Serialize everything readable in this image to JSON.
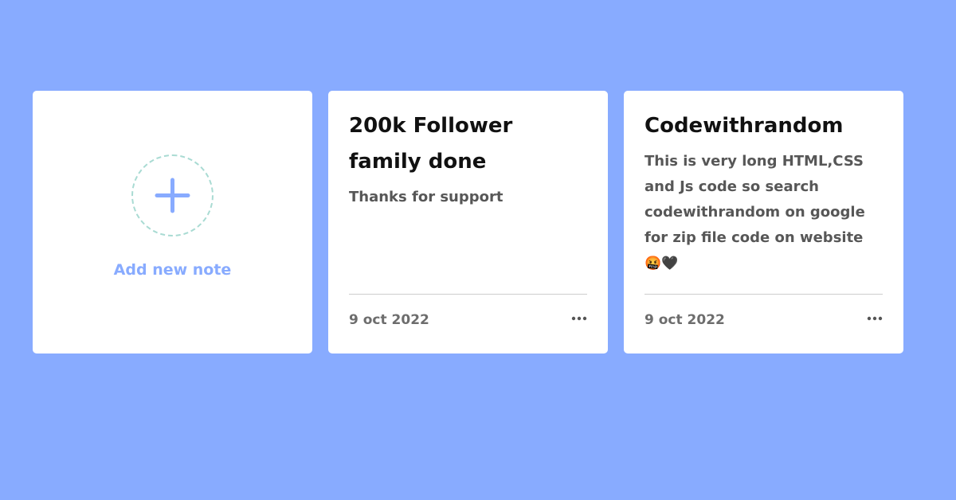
{
  "add_card": {
    "label": "Add new note",
    "icon": "plus-icon"
  },
  "notes": [
    {
      "title": "200k Follower family done",
      "description": "Thanks for support",
      "date": "9 oct 2022",
      "menu_icon": "more-horizontal-icon"
    },
    {
      "title": "Codewithrandom",
      "description": "This is very long HTML,CSS and Js code so search codewithrandom on google for zip file code on website",
      "emoji_1": "🤬",
      "emoji_2": "🖤",
      "date": "9 oct 2022",
      "menu_icon": "more-horizontal-icon"
    }
  ],
  "colors": {
    "background": "#88abff",
    "card": "#ffffff",
    "accent": "#88abff",
    "dashed_circle": "#a9dbd3"
  }
}
